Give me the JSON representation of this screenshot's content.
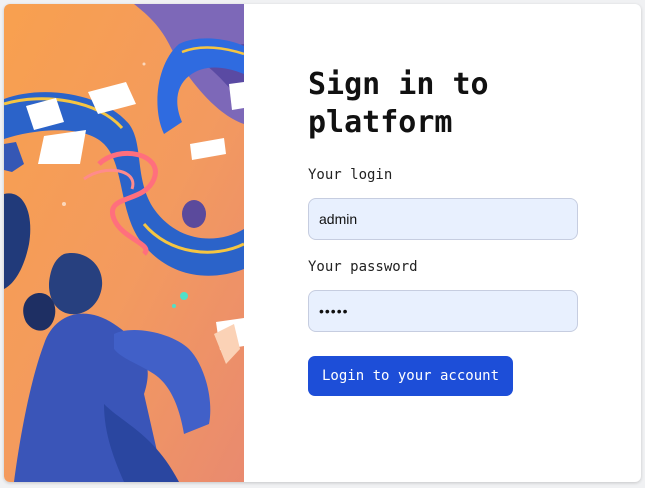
{
  "login_form": {
    "title": "Sign in to platform",
    "login_label": "Your login",
    "login_value": "admin",
    "password_label": "Your password",
    "password_value": "admin",
    "submit_label": "Login to your account"
  },
  "illustration": {
    "icon": "abstract-illustration"
  },
  "colors": {
    "accent": "#1d4ed8",
    "input_background": "#e8f0fe",
    "illustration_orange": "#f7a15a",
    "illustration_blue": "#2563eb"
  }
}
